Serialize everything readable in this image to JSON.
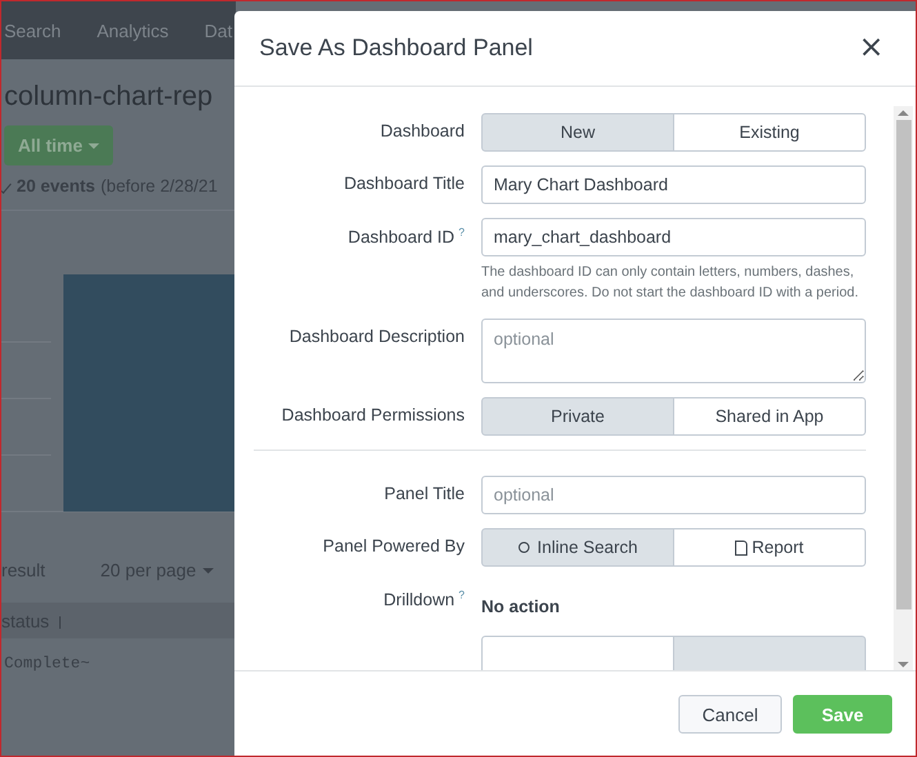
{
  "background": {
    "nav_tabs": [
      "Search",
      "Analytics",
      "Dat"
    ],
    "report_title": "column-chart-rep",
    "time_button": "All time",
    "events_summary": {
      "count": "20 events",
      "detail": "(before 2/28/21"
    },
    "result_count": "result",
    "per_page": "20 per page",
    "table": {
      "columns": [
        "status"
      ],
      "rows": [
        [
          "Complete~"
        ]
      ]
    }
  },
  "dialog": {
    "title": "Save As Dashboard Panel",
    "close": "×",
    "fields": [
      {
        "kind": "toggle",
        "label": "Dashboard",
        "options": [
          {
            "label": "New",
            "selected": true
          },
          {
            "label": "Existing",
            "selected": false
          }
        ]
      },
      {
        "kind": "input",
        "label": "Dashboard Title",
        "value": "Mary Chart Dashboard"
      },
      {
        "kind": "input",
        "label": "Dashboard ID",
        "help_mark": "?",
        "value": "mary_chart_dashboard",
        "help_text": "The dashboard ID can only contain letters, numbers, dashes, and underscores. Do not start the dashboard ID with a period."
      },
      {
        "kind": "textarea",
        "label": "Dashboard Description",
        "placeholder": "optional"
      },
      {
        "kind": "toggle",
        "label": "Dashboard Permissions",
        "options": [
          {
            "label": "Private",
            "selected": true
          },
          {
            "label": "Shared in App",
            "selected": false
          }
        ]
      },
      {
        "kind": "divider"
      },
      {
        "kind": "input",
        "label": "Panel Title",
        "placeholder": "optional"
      },
      {
        "kind": "toggle",
        "label": "Panel Powered By",
        "options": [
          {
            "label": "Inline Search",
            "kind": "search",
            "selected": true
          },
          {
            "label": "Report",
            "kind": "file",
            "selected": false
          }
        ]
      },
      {
        "kind": "static",
        "label": "Drilldown",
        "help_mark": "?",
        "value": "No action"
      },
      {
        "kind": "toggle",
        "options": [
          {
            "selected": false
          },
          {
            "selected": true
          }
        ]
      }
    ],
    "buttons": [
      {
        "label": "Cancel",
        "kind": "secondary"
      },
      {
        "label": "Save",
        "kind": "primary"
      }
    ]
  }
}
